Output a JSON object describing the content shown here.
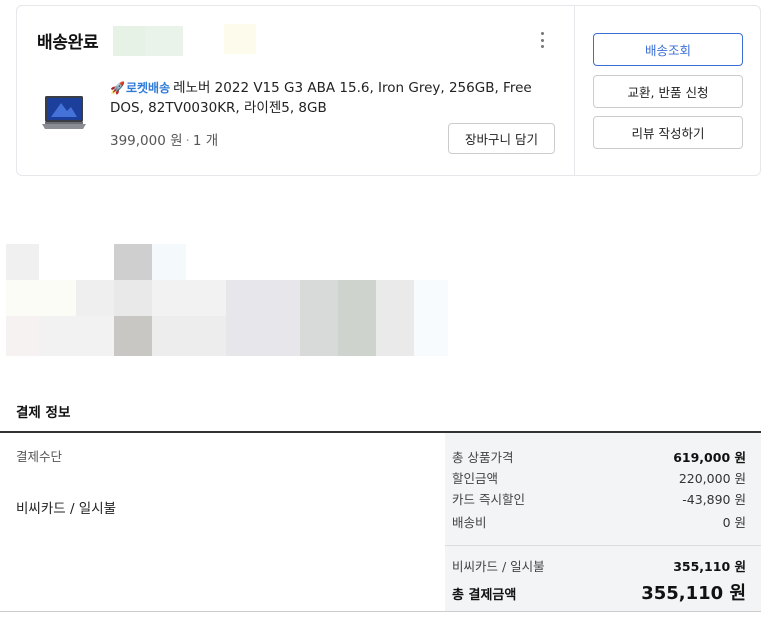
{
  "order": {
    "status": "배송완료",
    "product": {
      "badge": "로켓배송",
      "name": "레노버 2022 V15 G3 ABA 15.6, Iron Grey, 256GB, Free DOS, 82TV0030KR, 라이젠5, 8GB",
      "price": "399,000 원",
      "quantity": "1 개",
      "thumb_icon": "laptop-icon"
    },
    "cart_button": "장바구니 담기",
    "actions": {
      "track": "배송조회",
      "exchange_return": "교환, 반품 신청",
      "review": "리뷰 작성하기"
    },
    "colors": {
      "accent": "#3b6fd6",
      "rocket": "#2f7bd7"
    }
  },
  "payment": {
    "title": "결제 정보",
    "method_label": "결제수단",
    "method_value": "비씨카드 / 일시불",
    "summary": [
      {
        "label": "총 상품가격",
        "value": "619,000 원",
        "bold": true
      },
      {
        "label": "할인금액",
        "value": "220,000 원"
      },
      {
        "label": "카드 즉시할인",
        "value": "-43,890 원"
      },
      {
        "label": "배송비",
        "value": "0 원"
      }
    ],
    "card_line": {
      "label": "비씨카드 / 일시불",
      "value": "355,110 원"
    },
    "total": {
      "label": "총 결제금액",
      "value": "355,110 원"
    }
  }
}
